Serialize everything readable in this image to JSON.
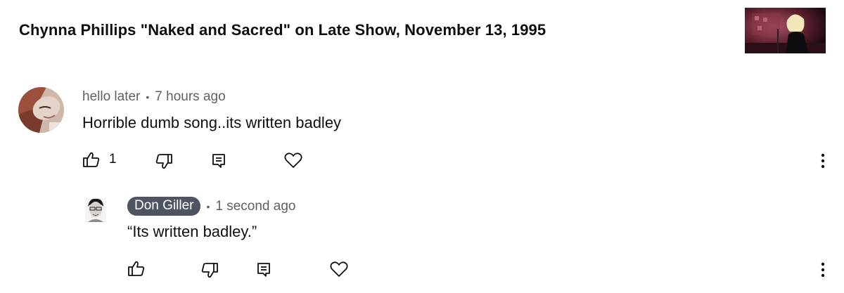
{
  "video": {
    "title": "Chynna Phillips \"Naked and Sacred\" on Late Show, November 13, 1995"
  },
  "comment": {
    "author": "hello later",
    "separator": "•",
    "time": "7 hours ago",
    "text": "Horrible dumb song..its written badley",
    "like_count": "1"
  },
  "reply": {
    "author": "Don Giller",
    "separator": "•",
    "time": "1 second ago",
    "text": "“Its written badley.”"
  },
  "icons": {
    "like": "thumbs-up-icon",
    "dislike": "thumbs-down-icon",
    "reply": "comment-reply-icon",
    "heart": "heart-icon",
    "more": "vertical-dots-icon"
  },
  "colors": {
    "meta_text": "#606060",
    "author_chip_bg": "#4e5461"
  }
}
